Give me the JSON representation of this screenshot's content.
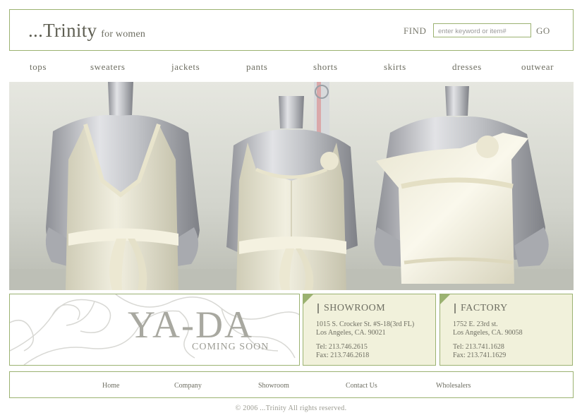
{
  "header": {
    "logo": "...Trinity",
    "logo_sub": "for women",
    "find_label": "FIND",
    "search_placeholder": "enter keyword or item#",
    "go_label": "GO"
  },
  "nav": {
    "items": [
      {
        "label": "tops"
      },
      {
        "label": "sweaters"
      },
      {
        "label": "jackets"
      },
      {
        "label": "pants"
      },
      {
        "label": "shorts"
      },
      {
        "label": "skirts"
      },
      {
        "label": "dresses"
      },
      {
        "label": "outwear"
      }
    ]
  },
  "hero": {
    "image_alt": "Three mannequins in cream lace tops and dresses"
  },
  "promo": {
    "title": "YA-DA",
    "subtitle": "COMING SOON"
  },
  "showroom": {
    "title": "SHOWROOM",
    "address1": "1015 S. Crocker St. #S-18(3rd FL)",
    "address2": "Los Angeles, CA. 90021",
    "tel": "Tel: 213.746.2615",
    "fax": "Fax: 213.746.2618"
  },
  "factory": {
    "title": "FACTORY",
    "address1": "1752 E. 23rd st.",
    "address2": "Los Angeles, CA. 90058",
    "tel": "Tel: 213.741.1628",
    "fax": "Fax: 213.741.1629"
  },
  "footer": {
    "links": [
      {
        "label": "Home"
      },
      {
        "label": "Company"
      },
      {
        "label": "Showroom"
      },
      {
        "label": "Contact Us"
      },
      {
        "label": "Wholesalers"
      }
    ],
    "copyright": "© 2006 ...Trinity All rights reserved."
  },
  "colors": {
    "border_green": "#9bb271",
    "card_bg": "#f1f1db",
    "text": "#6e6e62"
  }
}
